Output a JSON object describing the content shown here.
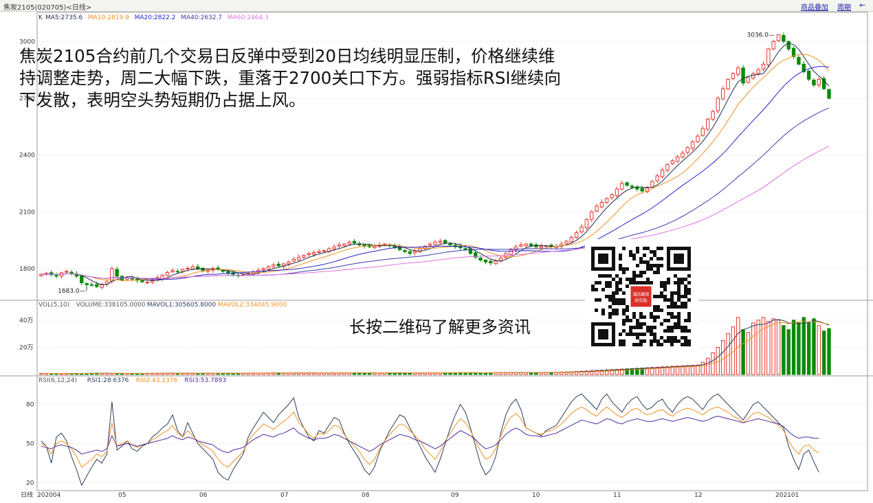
{
  "topbar": {
    "title": "焦炭2105(020705)<日线>",
    "link_overlay": "商品叠加",
    "link_period": "周期",
    "back_icon": "back-arrow-icon"
  },
  "commentary": "焦炭2105合约前几个交易日反弹中受到20日均线明显压制，价格继续维持调整走势，周二大幅下跌，重落于2700关口下方。强弱指标RSI继续向下发散，表明空头势短期仍占据上风。",
  "qr_caption": "长按二维码了解更多资讯",
  "qr_logo_text": [
    "瑞达期货",
    "研究院"
  ],
  "colors": {
    "up": "#e8332a",
    "down": "#0a8a0a",
    "ma5": "#1c2b4a",
    "ma10": "#f09020",
    "ma20": "#2222cc",
    "ma40": "#3a3ab0",
    "ma60": "#e070e0",
    "rsi1": "#2a3c5c",
    "rsi2": "#f09020",
    "rsi3": "#4a2aa0",
    "grid": "#d8d8c8"
  },
  "chart_data": [
    {
      "type": "candlestick",
      "legend_prefix": "K",
      "legend": [
        {
          "label": "MA5:2735.6",
          "color": "#1c2b4a"
        },
        {
          "label": "MA10:2819.9",
          "color": "#f09020"
        },
        {
          "label": "MA20:2822.2",
          "color": "#2222cc"
        },
        {
          "label": "MA40:2632.7",
          "color": "#3a3ab0"
        },
        {
          "label": "MA60:2464.3",
          "color": "#e070e0"
        }
      ],
      "y_ticks": [
        3000,
        2700,
        2400,
        2100,
        1800
      ],
      "ylim": [
        1640,
        3110
      ],
      "high_label": "3036.0",
      "low_label": "1683.0",
      "x_labels": [
        "202004",
        "05",
        "06",
        "07",
        "08",
        "09",
        "10",
        "11",
        "12",
        "202101"
      ],
      "x_label_prefix": "日线",
      "closes": [
        1770,
        1775,
        1768,
        1760,
        1778,
        1785,
        1772,
        1760,
        1725,
        1715,
        1712,
        1705,
        1718,
        1730,
        1800,
        1760,
        1740,
        1752,
        1745,
        1738,
        1730,
        1728,
        1740,
        1752,
        1765,
        1780,
        1790,
        1785,
        1795,
        1802,
        1810,
        1798,
        1790,
        1792,
        1800,
        1795,
        1785,
        1775,
        1770,
        1765,
        1768,
        1775,
        1780,
        1790,
        1800,
        1810,
        1820,
        1815,
        1825,
        1835,
        1850,
        1860,
        1870,
        1880,
        1885,
        1890,
        1895,
        1905,
        1915,
        1925,
        1930,
        1940,
        1935,
        1925,
        1920,
        1915,
        1918,
        1925,
        1930,
        1922,
        1910,
        1900,
        1890,
        1880,
        1892,
        1905,
        1918,
        1930,
        1940,
        1945,
        1935,
        1925,
        1915,
        1910,
        1905,
        1880,
        1860,
        1845,
        1835,
        1830,
        1840,
        1855,
        1880,
        1900,
        1915,
        1925,
        1930,
        1922,
        1915,
        1918,
        1920,
        1915,
        1918,
        1930,
        1945,
        1965,
        1990,
        2020,
        2060,
        2100,
        2130,
        2150,
        2170,
        2190,
        2220,
        2250,
        2240,
        2230,
        2220,
        2210,
        2230,
        2260,
        2290,
        2320,
        2350,
        2370,
        2390,
        2410,
        2440,
        2470,
        2500,
        2540,
        2590,
        2630,
        2700,
        2750,
        2800,
        2830,
        2860,
        2780,
        2810,
        2830,
        2850,
        2880,
        2960,
        3000,
        3036,
        3000,
        2960,
        2920,
        2880,
        2840,
        2800,
        2770,
        2800,
        2750,
        2700
      ]
    },
    {
      "type": "bar",
      "legend": [
        {
          "label": "VOL(5,10)",
          "color": "#555555"
        },
        {
          "label": "VOLUME:338105.0000",
          "color": "#555555"
        },
        {
          "label": "MAVOL1:305605.8000",
          "color": "#2a3c5c"
        },
        {
          "label": "MAVOL2:334045.9000",
          "color": "#f09020"
        }
      ],
      "y_ticks": [
        "40万",
        "20万"
      ],
      "ylim": [
        0,
        480000
      ],
      "values": [
        8000,
        7000,
        7500,
        8000,
        6000,
        7000,
        6500,
        7500,
        8000,
        9000,
        9500,
        10000,
        9000,
        8500,
        8000,
        8000,
        7500,
        7000,
        7500,
        8000,
        8000,
        8500,
        9000,
        8500,
        9000,
        9500,
        10000,
        9500,
        9000,
        8500,
        9000,
        8500,
        9000,
        9500,
        10000,
        9500,
        9000,
        8500,
        9000,
        9500,
        10000,
        10500,
        11000,
        10500,
        11000,
        11500,
        12000,
        11500,
        11000,
        10500,
        11000,
        11500,
        12000,
        12500,
        13000,
        12500,
        12000,
        11500,
        11000,
        12000,
        12500,
        13000,
        12500,
        12000,
        11500,
        11000,
        11500,
        12000,
        12500,
        13000,
        12500,
        12000,
        11500,
        11000,
        11500,
        12000,
        12500,
        13000,
        12500,
        12000,
        12500,
        13000,
        13500,
        14000,
        13500,
        13000,
        12500,
        12000,
        12500,
        13000,
        13500,
        14000,
        14500,
        15000,
        14500,
        14000,
        13500,
        13000,
        13500,
        14000,
        15000,
        16000,
        17000,
        18000,
        19000,
        20000,
        22000,
        24000,
        26000,
        28000,
        30000,
        32000,
        34000,
        36000,
        38000,
        40000,
        42000,
        44000,
        46000,
        48000,
        50000,
        52000,
        54000,
        56000,
        58000,
        60000,
        62000,
        64000,
        66000,
        68000,
        70000,
        90000,
        120000,
        160000,
        200000,
        250000,
        300000,
        350000,
        420000,
        330000,
        310000,
        380000,
        400000,
        420000,
        390000,
        410000,
        400000,
        360000,
        330000,
        400000,
        380000,
        420000,
        380000,
        410000,
        360000,
        320000,
        338105
      ]
    },
    {
      "type": "line",
      "legend": [
        {
          "label": "RSI(6,12,24)",
          "color": "#555555"
        },
        {
          "label": "RSI1:28.6376",
          "color": "#2a3c5c"
        },
        {
          "label": "RSI2:43.1376",
          "color": "#f09020"
        },
        {
          "label": "RSI3:53.7893",
          "color": "#4a2aa0"
        }
      ],
      "y_ticks": [
        80,
        50,
        20
      ],
      "ylim": [
        15,
        95
      ],
      "series": [
        {
          "name": "RSI1",
          "values": [
            52,
            48,
            35,
            55,
            58,
            52,
            40,
            30,
            18,
            25,
            32,
            38,
            35,
            42,
            82,
            45,
            48,
            52,
            46,
            44,
            48,
            50,
            55,
            58,
            62,
            65,
            72,
            60,
            55,
            66,
            58,
            50,
            46,
            42,
            38,
            28,
            24,
            22,
            30,
            36,
            42,
            55,
            62,
            68,
            74,
            70,
            66,
            72,
            76,
            80,
            85,
            70,
            62,
            55,
            52,
            60,
            58,
            64,
            70,
            68,
            58,
            50,
            44,
            38,
            30,
            26,
            32,
            44,
            52,
            60,
            66,
            72,
            70,
            62,
            55,
            48,
            40,
            34,
            28,
            38,
            50,
            62,
            72,
            80,
            74,
            62,
            48,
            34,
            26,
            30,
            40,
            58,
            72,
            80,
            84,
            76,
            62,
            60,
            58,
            56,
            60,
            62,
            64,
            70,
            76,
            82,
            86,
            88,
            84,
            80,
            76,
            84,
            88,
            82,
            78,
            74,
            80,
            84,
            86,
            80,
            76,
            78,
            82,
            84,
            78,
            74,
            80,
            84,
            86,
            84,
            80,
            76,
            82,
            86,
            88,
            84,
            80,
            76,
            72,
            68,
            74,
            80,
            82,
            78,
            74,
            70,
            66,
            62,
            48,
            38,
            30,
            42,
            45,
            36,
            28
          ]
        },
        {
          "name": "RSI2",
          "values": [
            50,
            48,
            42,
            50,
            52,
            50,
            46,
            40,
            32,
            35,
            38,
            42,
            40,
            44,
            66,
            48,
            50,
            52,
            49,
            47,
            49,
            50,
            53,
            55,
            58,
            60,
            64,
            58,
            55,
            60,
            56,
            52,
            49,
            47,
            44,
            38,
            34,
            32,
            36,
            40,
            44,
            52,
            57,
            61,
            65,
            63,
            61,
            64,
            67,
            70,
            74,
            66,
            62,
            57,
            54,
            58,
            57,
            60,
            64,
            63,
            57,
            52,
            48,
            44,
            38,
            34,
            38,
            46,
            52,
            57,
            61,
            65,
            64,
            60,
            56,
            52,
            46,
            42,
            38,
            44,
            52,
            58,
            64,
            69,
            66,
            60,
            52,
            44,
            38,
            40,
            46,
            56,
            64,
            70,
            73,
            69,
            62,
            60,
            58,
            57,
            59,
            60,
            62,
            65,
            69,
            73,
            76,
            78,
            76,
            73,
            71,
            75,
            78,
            75,
            72,
            70,
            73,
            76,
            77,
            74,
            72,
            73,
            75,
            76,
            73,
            71,
            74,
            76,
            77,
            76,
            74,
            72,
            75,
            77,
            78,
            76,
            74,
            71,
            69,
            66,
            69,
            73,
            74,
            72,
            70,
            67,
            64,
            60,
            52,
            46,
            42,
            48,
            49,
            45,
            43
          ]
        },
        {
          "name": "RSI3",
          "values": [
            48,
            47,
            46,
            48,
            49,
            48,
            47,
            45,
            42,
            43,
            44,
            45,
            44,
            46,
            56,
            48,
            49,
            50,
            49,
            48,
            49,
            50,
            51,
            52,
            53,
            54,
            56,
            54,
            53,
            55,
            54,
            52,
            51,
            50,
            49,
            46,
            44,
            43,
            45,
            46,
            47,
            50,
            53,
            55,
            57,
            56,
            55,
            57,
            58,
            60,
            62,
            58,
            56,
            54,
            53,
            54,
            54,
            55,
            57,
            56,
            54,
            52,
            50,
            48,
            46,
            44,
            46,
            49,
            51,
            53,
            55,
            57,
            56,
            55,
            53,
            52,
            50,
            48,
            46,
            48,
            51,
            54,
            57,
            60,
            58,
            56,
            53,
            49,
            46,
            47,
            49,
            53,
            57,
            60,
            62,
            60,
            57,
            56,
            56,
            55,
            56,
            57,
            58,
            60,
            62,
            64,
            66,
            68,
            67,
            66,
            65,
            67,
            69,
            68,
            66,
            65,
            67,
            68,
            69,
            68,
            67,
            67,
            68,
            69,
            68,
            67,
            68,
            69,
            70,
            69,
            68,
            67,
            68,
            70,
            71,
            70,
            69,
            68,
            67,
            66,
            67,
            68,
            69,
            68,
            67,
            66,
            65,
            63,
            59,
            56,
            54,
            55,
            55,
            54,
            54
          ]
        }
      ]
    }
  ]
}
